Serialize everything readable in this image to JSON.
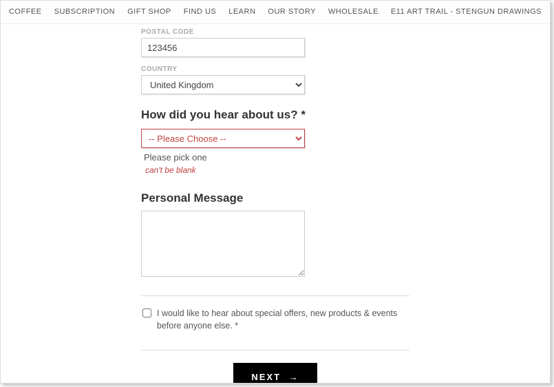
{
  "nav": {
    "items": [
      "COFFEE",
      "SUBSCRIPTION",
      "GIFT SHOP",
      "FIND US",
      "LEARN",
      "OUR STORY",
      "WHOLESALE",
      "E11 ART TRAIL - STENGUN DRAWINGS"
    ]
  },
  "form": {
    "postal": {
      "label": "POSTAL CODE",
      "value": "123456"
    },
    "country": {
      "label": "COUNTRY",
      "value": "United Kingdom"
    },
    "hear": {
      "heading": "How did you hear about us? *",
      "value": "-- Please Choose --",
      "hint": "Please pick one",
      "error": "can't be blank"
    },
    "message": {
      "heading": "Personal Message",
      "value": ""
    },
    "optin": {
      "label": "I would like to hear about special offers, new products & events before anyone else. *"
    },
    "next": {
      "label": "NEXT",
      "arrow": "→"
    }
  }
}
